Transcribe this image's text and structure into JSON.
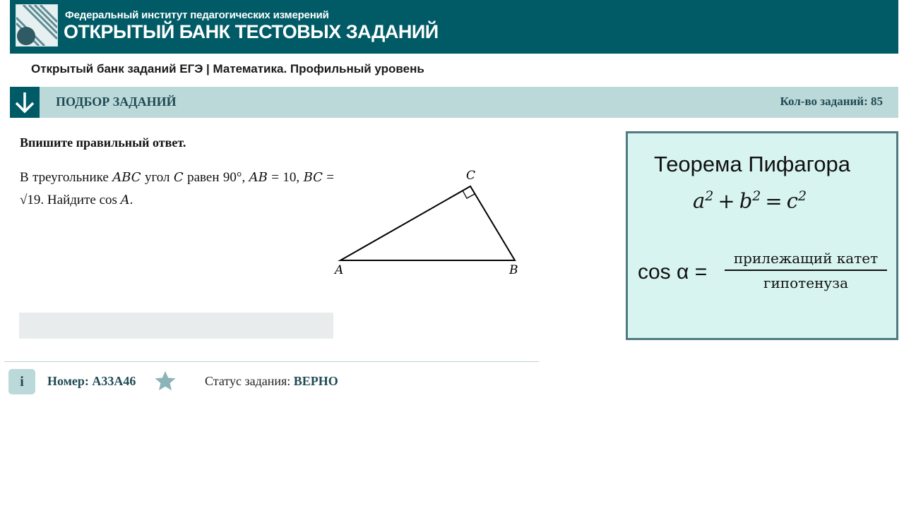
{
  "header": {
    "institute": "Федеральный институт педагогических измерений",
    "bank_title": "ОТКРЫТЫЙ БАНК ТЕСТОВЫХ ЗАДАНИЙ"
  },
  "breadcrumb": "Открытый банк заданий ЕГЭ | Математика. Профильный уровень",
  "selection_bar": {
    "title": "ПОДБОР ЗАДАНИЙ",
    "count_label": "Кол-во заданий: 85"
  },
  "task": {
    "instruction": "Впишите правильный ответ.",
    "text_parts": {
      "p1": "В треугольнике ",
      "abc": "ABC",
      "p2": " угол ",
      "c": "C",
      "p3": " равен 90°,",
      "ab": "AB",
      "p4": " = 10, ",
      "bc": "BC",
      "p5": " = √19. Найдите cos ",
      "a": "A",
      "p6": "."
    },
    "figure_labels": {
      "a": "A",
      "b": "B",
      "c": "C"
    },
    "answer_value": ""
  },
  "footer": {
    "info_icon_text": "i",
    "number_label": "Номер: A33A46",
    "status_label": "Статус задания: ",
    "status_value": "ВЕРНО"
  },
  "theory": {
    "title": "Теорема Пифагора",
    "formula_a": "a",
    "formula_b": "b",
    "formula_c": "c",
    "exp": "2",
    "plus": "+",
    "eq": "=",
    "cos_label": "cos α =",
    "numerator": "прилежащий катет",
    "denominator": "гипотенуза"
  },
  "colors": {
    "header_bg": "#005b66",
    "bar_bg": "#bcd9d9",
    "theory_bg": "#d7f4f0",
    "theory_border": "#4f7b80"
  }
}
